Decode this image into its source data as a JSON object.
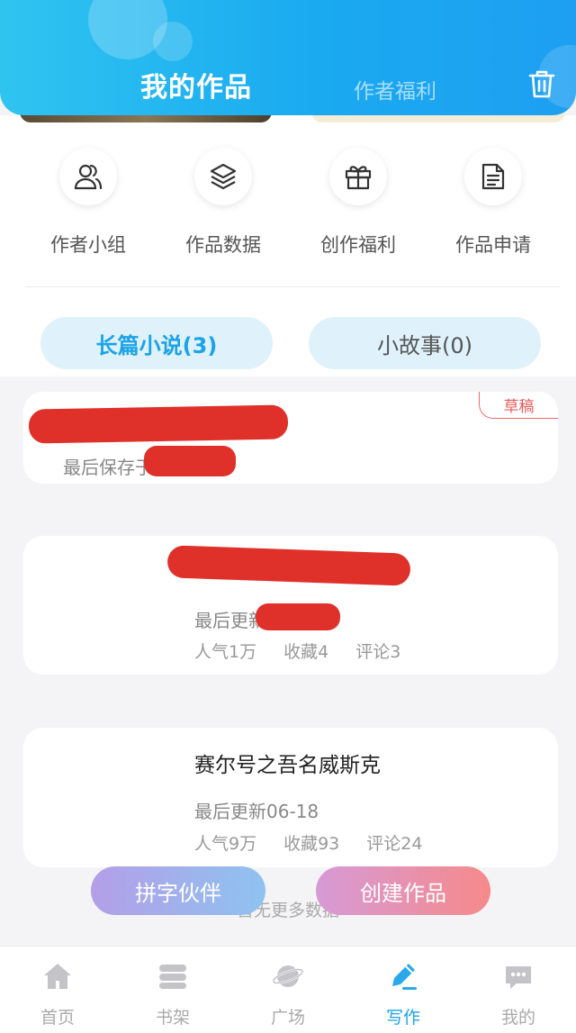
{
  "header": {
    "active_tab": "我的作品",
    "other_tab": "作者福利"
  },
  "quick_actions": [
    {
      "label": "作者小组",
      "icon": "people-icon"
    },
    {
      "label": "作品数据",
      "icon": "layers-icon"
    },
    {
      "label": "创作福利",
      "icon": "gift-icon"
    },
    {
      "label": "作品申请",
      "icon": "document-icon"
    }
  ],
  "segments": {
    "long_novel": "长篇小说(3)",
    "short_story": "小故事(0)"
  },
  "works": [
    {
      "badge": "草稿",
      "saved": "最后保存于"
    },
    {
      "updated": "最后更新",
      "popularity": "人气1万",
      "favorites": "收藏4",
      "comments": "评论3"
    },
    {
      "title": "赛尔号之吾名威斯克",
      "updated": "最后更新06-18",
      "popularity": "人气9万",
      "favorites": "收藏93",
      "comments": "评论24"
    }
  ],
  "no_more": "暂无更多数据",
  "fab": {
    "partner": "拼字伙伴",
    "create": "创建作品"
  },
  "bottom_nav": [
    {
      "label": "首页",
      "icon": "home-icon"
    },
    {
      "label": "书架",
      "icon": "bookshelf-icon"
    },
    {
      "label": "广场",
      "icon": "planet-icon"
    },
    {
      "label": "写作",
      "icon": "pen-icon",
      "active": true
    },
    {
      "label": "我的",
      "icon": "chat-icon"
    }
  ],
  "colors": {
    "accent": "#1aa3e8",
    "draft": "#e85b5b"
  }
}
